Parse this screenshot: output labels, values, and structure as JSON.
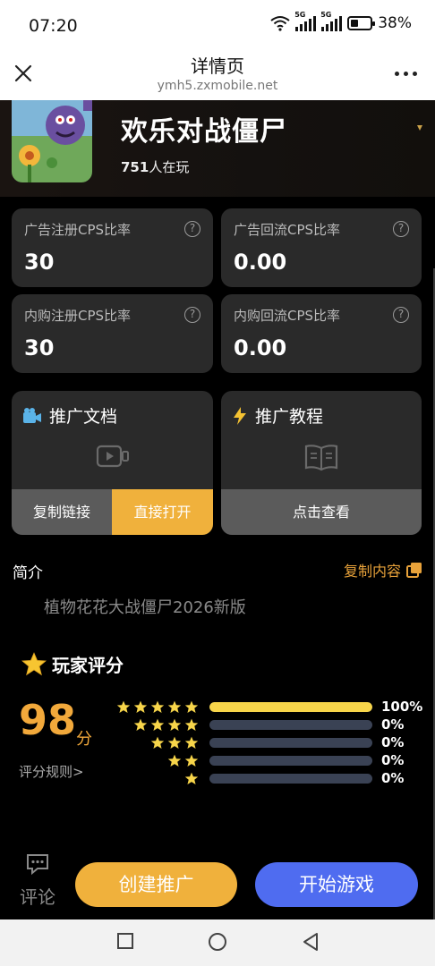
{
  "status_bar": {
    "time": "07:20",
    "network_1": "5G",
    "network_2": "5G",
    "battery": "38%"
  },
  "browser": {
    "title": "详情页",
    "url": "ymh5.zxmobile.net"
  },
  "game": {
    "name": "欢乐对战僵尸",
    "players_count": "751",
    "players_suffix": "人在玩"
  },
  "stats": [
    {
      "label": "广告注册CPS比率",
      "value": "30"
    },
    {
      "label": "广告回流CPS比率",
      "value": "0.00"
    },
    {
      "label": "内购注册CPS比率",
      "value": "30"
    },
    {
      "label": "内购回流CPS比率",
      "value": "0.00"
    }
  ],
  "promo_doc": {
    "title": "推广文档",
    "copy_link": "复制链接",
    "open_direct": "直接打开"
  },
  "promo_tutorial": {
    "title": "推广教程",
    "view": "点击查看"
  },
  "intro": {
    "label": "简介",
    "copy_content": "复制内容",
    "text": "植物花花大战僵尸2026新版"
  },
  "rating": {
    "title": "玩家评分",
    "score": "98",
    "unit": "分",
    "rule_link": "评分规则>",
    "rows": [
      {
        "stars": 5,
        "percent": "100%",
        "fill": 1.0
      },
      {
        "stars": 4,
        "percent": "0%",
        "fill": 0.0
      },
      {
        "stars": 3,
        "percent": "0%",
        "fill": 0.0
      },
      {
        "stars": 2,
        "percent": "0%",
        "fill": 0.0
      },
      {
        "stars": 1,
        "percent": "0%",
        "fill": 0.0
      }
    ]
  },
  "actions": {
    "comment": "评论",
    "create": "创建推广",
    "play": "开始游戏"
  },
  "colors": {
    "accent_orange": "#f0b13c",
    "score_orange": "#f2a93b",
    "play_blue": "#4f6cf0",
    "star_yellow": "#f7d54a",
    "card_bg": "#2a2a2a"
  }
}
